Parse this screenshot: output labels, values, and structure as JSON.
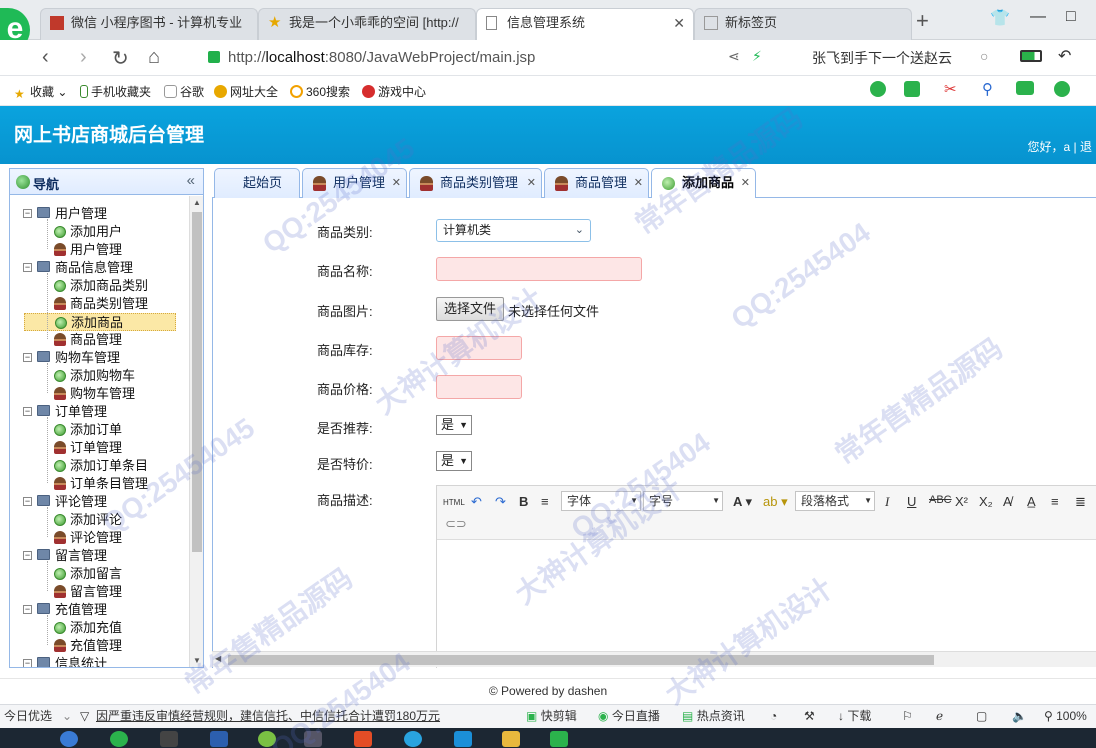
{
  "browser": {
    "tabs": [
      {
        "title": "微信 小程序图书 - 计算机专业",
        "icon": "wechat-icon"
      },
      {
        "title": "我是一个小乖乖的空间 [http://",
        "icon": "star-icon"
      },
      {
        "title": "信息管理系统",
        "icon": "page-icon",
        "active": true
      },
      {
        "title": "新标签页",
        "icon": "grid-icon"
      }
    ],
    "url_prefix": "http://",
    "url_host": "localhost",
    "url_rest": ":8080/JavaWebProject/main.jsp",
    "ad_text": "张飞到手下一个送赵云",
    "bookmarks": [
      "收藏",
      "手机收藏夹",
      "谷歌",
      "网址大全",
      "360搜索",
      "游戏中心"
    ]
  },
  "header": {
    "title": "网上书店商城后台管理",
    "greeting": "您好，a | 退"
  },
  "sidebar": {
    "title": "导航",
    "groups": [
      {
        "label": "用户管理",
        "items": [
          {
            "label": "添加用户",
            "type": "add"
          },
          {
            "label": "用户管理",
            "type": "user"
          }
        ]
      },
      {
        "label": "商品信息管理",
        "items": [
          {
            "label": "添加商品类别",
            "type": "add"
          },
          {
            "label": "商品类别管理",
            "type": "user"
          },
          {
            "label": "添加商品",
            "type": "add",
            "selected": true
          },
          {
            "label": "商品管理",
            "type": "user"
          }
        ]
      },
      {
        "label": "购物车管理",
        "items": [
          {
            "label": "添加购物车",
            "type": "add"
          },
          {
            "label": "购物车管理",
            "type": "user"
          }
        ]
      },
      {
        "label": "订单管理",
        "items": [
          {
            "label": "添加订单",
            "type": "add"
          },
          {
            "label": "订单管理",
            "type": "user"
          },
          {
            "label": "添加订单条目",
            "type": "add"
          },
          {
            "label": "订单条目管理",
            "type": "user"
          }
        ]
      },
      {
        "label": "评论管理",
        "items": [
          {
            "label": "添加评论",
            "type": "add"
          },
          {
            "label": "评论管理",
            "type": "user"
          }
        ]
      },
      {
        "label": "留言管理",
        "items": [
          {
            "label": "添加留言",
            "type": "add"
          },
          {
            "label": "留言管理",
            "type": "user"
          }
        ]
      },
      {
        "label": "充值管理",
        "items": [
          {
            "label": "添加充值",
            "type": "add"
          },
          {
            "label": "充值管理",
            "type": "user"
          }
        ]
      },
      {
        "label": "信息统计",
        "items": []
      }
    ]
  },
  "tabs": [
    {
      "label": "起始页",
      "icon": "none"
    },
    {
      "label": "用户管理",
      "icon": "user"
    },
    {
      "label": "商品类别管理",
      "icon": "user"
    },
    {
      "label": "商品管理",
      "icon": "user"
    },
    {
      "label": "添加商品",
      "icon": "add",
      "active": true
    }
  ],
  "form": {
    "category_label": "商品类别:",
    "category_value": "计算机类",
    "name_label": "商品名称:",
    "image_label": "商品图片:",
    "file_button": "选择文件",
    "file_status": "未选择任何文件",
    "stock_label": "商品库存:",
    "price_label": "商品价格:",
    "recommend_label": "是否推荐:",
    "recommend_value": "是",
    "special_label": "是否特价:",
    "special_value": "是",
    "desc_label": "商品描述:"
  },
  "editor": {
    "font_label": "字体",
    "size_label": "字号",
    "format_label": "段落格式",
    "html_label": "HTML"
  },
  "footer": "© Powered by dashen",
  "statusbar": {
    "left": "今日优选",
    "news": "因严重违反审慎经营规则，建信信托、中信信托合计遭罚180万元",
    "items": [
      "快剪辑",
      "今日直播",
      "热点资讯",
      "下载",
      "100%"
    ]
  },
  "watermarks": [
    "QQ:25454045",
    "常年售精品源码",
    "大神计算机设计",
    "QQ:2545404",
    "常年售精品源码",
    "QQ:25454045",
    "大神计算机设计",
    "QQ:2545404",
    "常年售精品源码",
    "大神计算机设计",
    "QQ:2545404"
  ]
}
